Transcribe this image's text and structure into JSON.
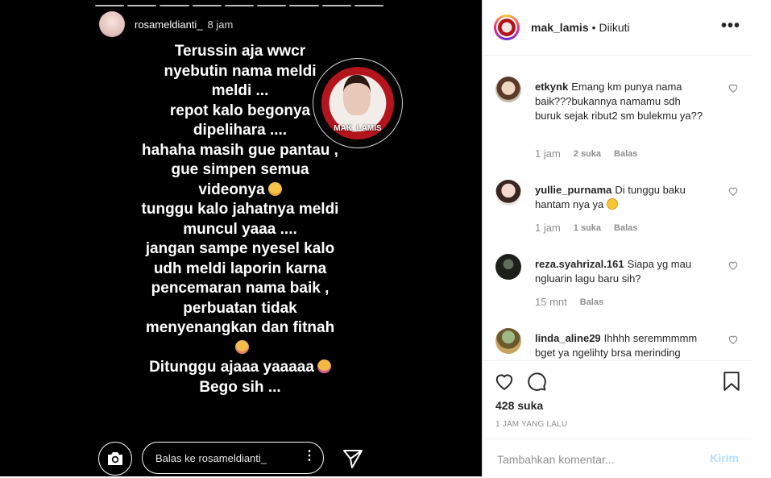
{
  "story": {
    "username": "rosameldianti_",
    "time": "8 jam",
    "progress_segments": 9,
    "lines": [
      "Terussin aja wwcr",
      "nyebutin nama meldi",
      "meldi  ...",
      "repot kalo begonya",
      "dipelihara ....",
      "hahaha masih gue pantau ,",
      "gue simpen semua",
      "videonya",
      "tunggu kalo jahatnya meldi",
      "muncul yaaa ....",
      "jangan sampe nyesel kalo",
      "udh meldi laporin karna",
      "pencemaran nama baik ,",
      "perbuatan tidak",
      "menyenangkan dan fitnah",
      "",
      "Ditunggu ajaaa yaaaaa",
      "Bego sih ..."
    ],
    "sticker_label": "MAK_LAMIS",
    "reply_placeholder": "Balas ke rosameldianti_"
  },
  "post": {
    "username": "mak_lamis",
    "separator": "•",
    "follow_status": "Diikuti",
    "more_label": "•••",
    "likes": "428 suka",
    "time_ago": "1 JAM YANG LALU",
    "comment_placeholder": "Tambahkan komentar...",
    "post_button": "Kirim"
  },
  "comments": [
    {
      "user": "etkynk",
      "text": "Emang km punya nama baik???bukannya namamu sdh buruk sejak ribut2 sm bulekmu ya??",
      "time": "1 jam",
      "likes": "2 suka",
      "reply": "Balas"
    },
    {
      "user": "yullie_purnama",
      "text": "Di tunggu baku hantam nya ya",
      "time": "1 jam",
      "likes": "1 suka",
      "reply": "Balas"
    },
    {
      "user": "reza.syahrizal.161",
      "text": "Siapa yg mau ngluarin lagu baru sih?",
      "time": "15 mnt",
      "likes": "",
      "reply": "Balas"
    },
    {
      "user": "linda_aline29",
      "text": "Ihhhh seremmmmm bget ya ngelihty brsa merinding",
      "time": "",
      "likes": "",
      "reply": ""
    }
  ],
  "icons": {
    "camera": "camera-icon",
    "send": "send-icon",
    "heart": "heart-icon",
    "comment": "comment-icon",
    "bookmark": "bookmark-icon",
    "more": "more-icon"
  },
  "colors": {
    "story_bg": "#000000",
    "text_dark": "#262626",
    "text_muted": "#8e8e8e",
    "post_button": "#b2dffc",
    "sticker_red": "#b4151c"
  }
}
